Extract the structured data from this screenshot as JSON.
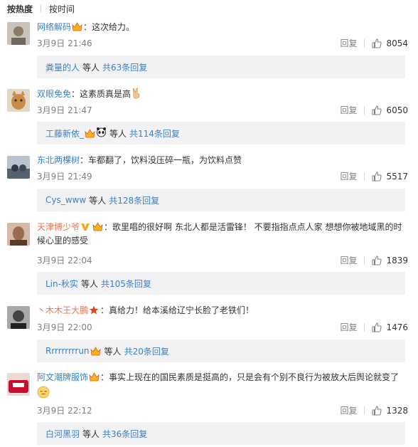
{
  "tabs": {
    "hot": "按热度",
    "time": "按时间"
  },
  "reply_label": "回复",
  "and_others": "等人",
  "comments": [
    {
      "user": "网络解码",
      "text": "：这次给力。",
      "time": "3月9日 21:46",
      "likes": "8054",
      "sub": {
        "user": "粪量的人",
        "total": "共63条回复"
      }
    },
    {
      "user": "双眼免免",
      "text": "：这素质真是高",
      "time": "3月9日 21:47",
      "likes": "6050",
      "sub": {
        "user": "工藤新依_",
        "total": "共114条回复"
      }
    },
    {
      "user": "东北两棵树",
      "text": "：车都翻了，饮料没压碎一瓶，为饮料点赞",
      "time": "3月9日 21:49",
      "likes": "5517",
      "sub": {
        "user": "Cys_www",
        "total": "共128条回复"
      }
    },
    {
      "user": "天津博少爷",
      "text": "：歌里唱的很好啊 东北人都是活雷锋！ 不要指指点点人家 想想你被地域黑的时候心里的感受",
      "time": "3月9日 22:04",
      "likes": "1839",
      "sub": {
        "user": "Lin-秋实",
        "total": "共105条回复"
      }
    },
    {
      "user": "丶木木王大鹏",
      "text": "：真给力！给本溪给辽宁长脸了老铁们！",
      "time": "3月9日 22:00",
      "likes": "1476",
      "sub": {
        "user": "Rrrrrrrrrun",
        "total": "共20条回复"
      }
    },
    {
      "user": "阿文潮牌服饰",
      "text": "：事实上现在的国民素质是挺高的，只是会有个别不良行为被放大后舆论就变了",
      "time": "3月9日 22:12",
      "likes": "1328",
      "sub": {
        "user": "白河黑羽",
        "total": "共36条回复"
      }
    }
  ]
}
